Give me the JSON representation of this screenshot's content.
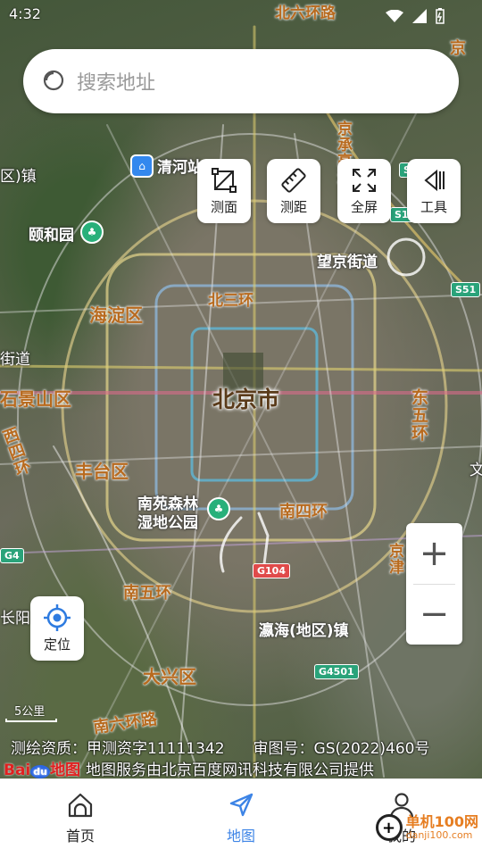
{
  "status_bar": {
    "time": "4:32"
  },
  "search": {
    "placeholder": "搜索地址"
  },
  "tools": [
    {
      "label": "测面",
      "icon": "polygon-measure-icon"
    },
    {
      "label": "测距",
      "icon": "ruler-icon"
    },
    {
      "label": "全屏",
      "icon": "fullscreen-icon"
    },
    {
      "label": "工具",
      "icon": "tools-icon"
    }
  ],
  "locate": {
    "label": "定位"
  },
  "zoom": {
    "in": "+",
    "out": "−"
  },
  "map": {
    "labels": {
      "beijing": "北京市",
      "haidian": "海淀区",
      "fengtai": "丰台区",
      "daxing": "大兴区",
      "shijingshan": "石景山区",
      "yiheyuan": "颐和园",
      "qinghe": "清河站",
      "nanyuan1": "南苑森林",
      "nanyuan2": "湿地公园",
      "wangjing": "望京街道",
      "yinghai": "瀛海(地区)镇",
      "beisanhuan": "北三环",
      "nansihuan": "南四环",
      "nanwuhuan": "南五环",
      "nanliuhuan": "南六环路",
      "dongwuhuan": "东五环",
      "xisihuan": "西四环",
      "jingcheng": "京承高速",
      "beiliuhuan": "北六环路",
      "jie": "街道",
      "zhen": "区)镇",
      "wen": "文",
      "chang": "长阳",
      "jing": "京",
      "jingjin": "京津"
    },
    "road_signs": [
      "G104",
      "G4501",
      "S51",
      "S12",
      "G4",
      "S5"
    ]
  },
  "scale": {
    "label": "5公里"
  },
  "attribution": {
    "qualification": "测绘资质：甲测资字11111342",
    "review_no": "审图号：GS(2022)460号",
    "logo_text": "Bai",
    "logo_du": "du",
    "logo_suffix": "地图",
    "provider": "地图服务由北京百度网讯科技有限公司提供"
  },
  "nav": [
    {
      "label": "首页",
      "icon": "home-icon",
      "active": false
    },
    {
      "label": "地图",
      "icon": "navigate-arrow-icon",
      "active": true
    },
    {
      "label": "我的",
      "icon": "user-icon",
      "active": false
    }
  ],
  "watermark": {
    "name": "单机100网",
    "url": "danji100.com"
  },
  "colors": {
    "accent": "#3d84e6",
    "map_label": "#b86a1e"
  }
}
